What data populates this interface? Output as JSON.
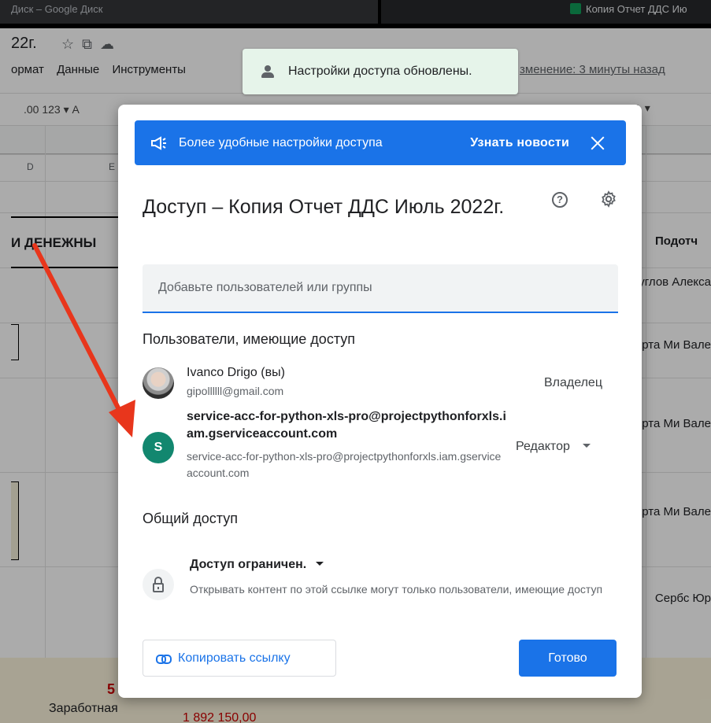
{
  "browser": {
    "tab_left": "Диск – Google Диск",
    "tab_right": "Копия Отчет ДДС Ию"
  },
  "sheet": {
    "title": "22г.",
    "menu": [
      "ормат",
      "Данные",
      "Инструменты"
    ],
    "last_edit": "зменение: 3 минуты назад",
    "toolbar_left": ".00  123 ▾    А",
    "col_d": "D",
    "col_e": "E",
    "heading": "И ДЕНЕЖНЫ",
    "right_header": "Подотч",
    "right_cells": [
      "Круглов Алекса",
      "Арта Ми Вале",
      "Арта Ми Вале",
      "Арта Ми Вале",
      "Сербс Юр"
    ],
    "bottom_value": "5",
    "bottom_label": "Заработная",
    "bottom_amount": "1 892 150,00"
  },
  "toast": {
    "message": "Настройки доступа обновлены."
  },
  "dialog": {
    "banner": {
      "text": "Более удобные настройки доступа",
      "action": "Узнать новости"
    },
    "title": "Доступ – Копия Отчет ДДС Июль 2022г.",
    "add_placeholder": "Добавьте пользователей или группы",
    "users_heading": "Пользователи, имеющие доступ",
    "users": [
      {
        "name": "Ivanco Drigo (вы)",
        "email": "gipollllll@gmail.com",
        "role": "Владелец"
      },
      {
        "avatar_letter": "S",
        "name": "service-acc-for-python-xls-pro@projectpythonforxls.iam.gserviceaccount.com",
        "email": "service-acc-for-python-xls-pro@projectpythonforxls.iam.gserviceaccount.com",
        "role": "Редактор"
      }
    ],
    "general_heading": "Общий доступ",
    "access": {
      "label": "Доступ ограничен.",
      "description": "Открывать контент по этой ссылке могут только пользователи, имеющие доступ"
    },
    "copy_link": "Копировать ссылку",
    "done": "Готово"
  },
  "colors": {
    "accent": "#1a73e8",
    "avatar_s": "#12876f",
    "toast_bg": "#e6f4ea",
    "arrow": "#e8361c"
  }
}
